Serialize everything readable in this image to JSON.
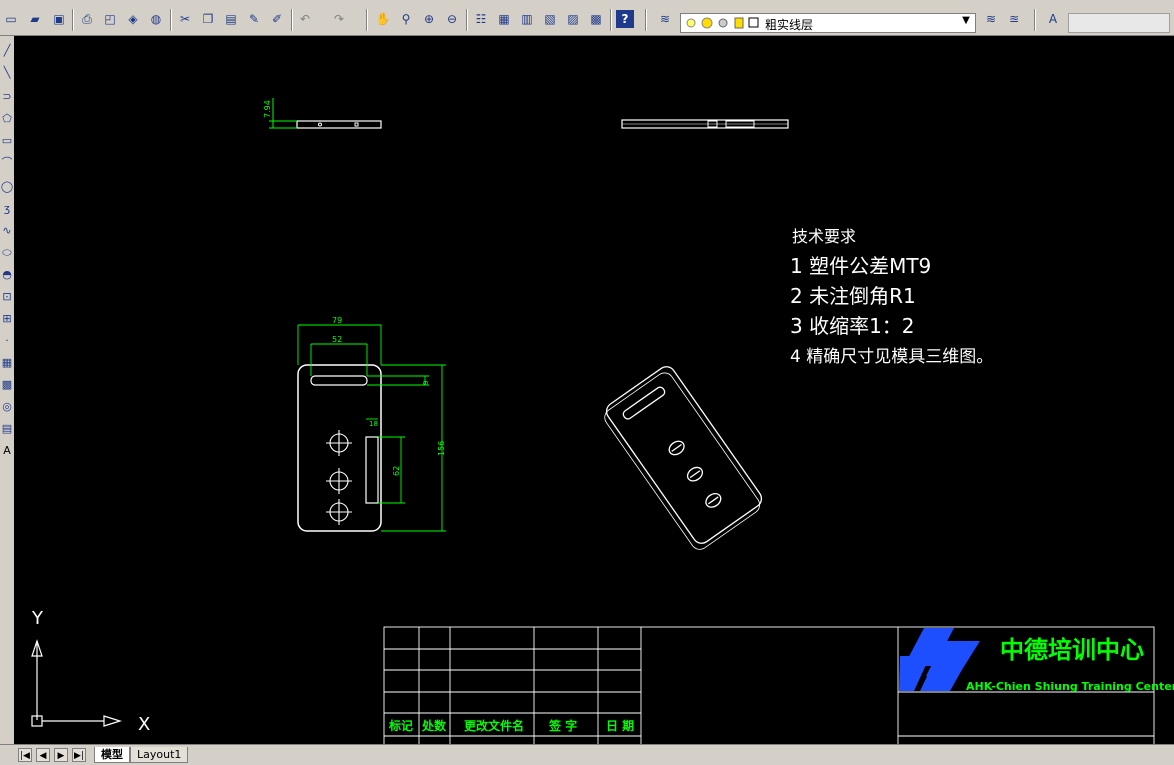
{
  "toolbar": {
    "layer_name": "粗实线层",
    "icons": [
      "new-icon",
      "open-icon",
      "save-icon",
      "plot-icon",
      "plot-preview-icon",
      "publish-icon",
      "3d-dwf-icon",
      "cut-icon",
      "copy-icon",
      "paste-icon",
      "match-properties-icon",
      "block-editor-icon",
      "undo-icon",
      "redo-icon",
      "pan-icon",
      "zoom-realtime-icon",
      "zoom-window-icon",
      "zoom-previous-icon",
      "properties-icon",
      "design-center-icon",
      "tool-palettes-icon",
      "sheet-set-icon",
      "markup-icon",
      "quickcalc-icon",
      "help-icon",
      "layer-manager-icon",
      "layer-previous-icon",
      "layer-state-icon",
      "text-style-icon"
    ]
  },
  "left_toolbar": {
    "icons": [
      "line-icon",
      "construction-line-icon",
      "polyline-icon",
      "polygon-icon",
      "rectangle-icon",
      "arc-icon",
      "circle-icon",
      "revision-cloud-icon",
      "spline-icon",
      "ellipse-icon",
      "ellipse-arc-icon",
      "insert-block-icon",
      "make-block-icon",
      "point-icon",
      "hatch-icon",
      "gradient-icon",
      "region-icon",
      "table-icon",
      "multiline-text-icon"
    ]
  },
  "drawing": {
    "tech_req_title": "技术要求",
    "tech_req_1": "1 塑件公差MT9",
    "tech_req_2": "2 未注倒角R1",
    "tech_req_3": "3 收缩率1：2",
    "tech_req_4": "4 精确尺寸见模具三维图。",
    "dim_thickness": "7.94",
    "dim_width": "79",
    "dim_slot_width": "52",
    "dim_slot_height": "9",
    "dim_height": "156",
    "dim_small": "18",
    "dim_62": "62",
    "ucs_x": "X",
    "ucs_y": "Y"
  },
  "title_block": {
    "col_mark": "标记",
    "col_count": "处数",
    "col_doc": "更改文件名",
    "col_sign": "签 字",
    "col_date": "日 期",
    "company_cn": "中德培训中心",
    "company_en": "AHK-Chien Shiung Training Center"
  },
  "tabs": {
    "model": "模型",
    "layout1": "Layout1"
  },
  "colors": {
    "canvas_bg": "#000000",
    "geometry": "#ffffff",
    "dimension": "#00ff00",
    "logo_blue": "#1e4fff"
  }
}
